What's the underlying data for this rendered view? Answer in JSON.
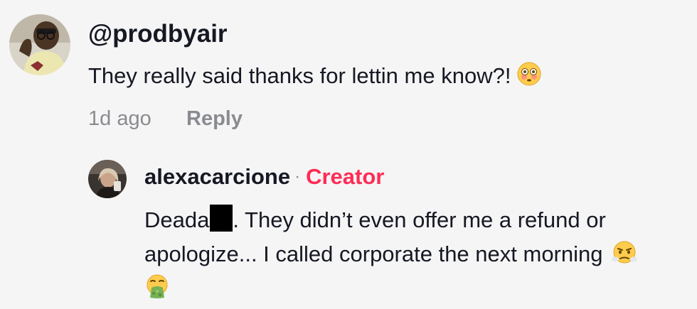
{
  "comment": {
    "username": "@prodbyair",
    "text": "They really said thanks for lettin me know?!",
    "emoji": "flushed-face-emoji",
    "timestamp": "1d ago",
    "reply_label": "Reply"
  },
  "reply": {
    "username": "alexacarcione",
    "separator": "·",
    "badge": "Creator",
    "text_before_censor": "Deada",
    "text_after_censor": ". They didn’t even offer me a refund or",
    "text_line2": "apologize... I called corporate the next morning",
    "emojis": [
      "face-with-steam-from-nose-emoji",
      "vomiting-face-emoji"
    ]
  },
  "colors": {
    "background": "#f5f5f5",
    "text_primary": "#161823",
    "text_muted": "#8a8b91",
    "creator_badge": "#fe2c55"
  }
}
